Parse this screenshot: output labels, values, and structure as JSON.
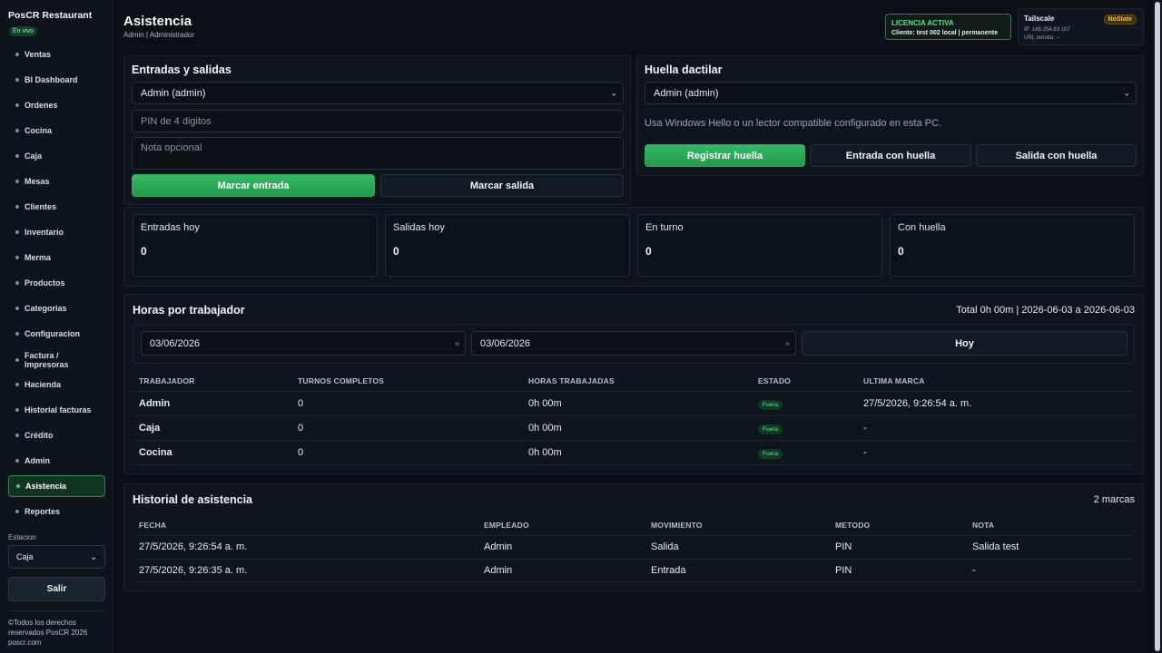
{
  "sidebar": {
    "brand": "PosCR Restaurant",
    "status_badge": "En vivo",
    "items": [
      {
        "label": "Ventas"
      },
      {
        "label": "BI Dashboard"
      },
      {
        "label": "Ordenes"
      },
      {
        "label": "Cocina"
      },
      {
        "label": "Caja"
      },
      {
        "label": "Mesas"
      },
      {
        "label": "Clientes"
      },
      {
        "label": "Inventario"
      },
      {
        "label": "Merma"
      },
      {
        "label": "Productos"
      },
      {
        "label": "Categorias"
      },
      {
        "label": "Configuracion"
      },
      {
        "label": "Factura / Impresoras"
      },
      {
        "label": "Hacienda"
      },
      {
        "label": "Historial facturas"
      },
      {
        "label": "Crédito"
      },
      {
        "label": "Admin"
      },
      {
        "label": "Asistencia",
        "active": true
      },
      {
        "label": "Reportes"
      }
    ],
    "station_label": "Estacion",
    "station_value": "Caja",
    "logout_label": "Salir",
    "footer": "©Todos los derechos reservados PosCR 2026 poscr.com"
  },
  "header": {
    "title": "Asistencia",
    "subtitle": "Admin | Administrador",
    "license_title": "LICENCIA ACTIVA",
    "license_detail": "Cliente: test 002 local | permanente",
    "tailscale_title": "Tailscale",
    "tailscale_badge": "NoState",
    "tailscale_ip": "IP: 169.254.83.107",
    "tailscale_url": "URL remota: --"
  },
  "entries": {
    "title": "Entradas y salidas",
    "employee_select": "Admin (admin)",
    "pin_placeholder": "PIN de 4 digitos",
    "note_placeholder": "Nota opcional",
    "checkin_label": "Marcar entrada",
    "checkout_label": "Marcar salida"
  },
  "fingerprint": {
    "title": "Huella dactilar",
    "employee_select": "Admin (admin)",
    "hint": "Usa Windows Hello o un lector compatible configurado en esta PC.",
    "register_label": "Registrar huella",
    "checkin_label": "Entrada con huella",
    "checkout_label": "Salida con huella"
  },
  "stats": [
    {
      "label": "Entradas hoy",
      "value": "0"
    },
    {
      "label": "Salidas hoy",
      "value": "0"
    },
    {
      "label": "En turno",
      "value": "0"
    },
    {
      "label": "Con huella",
      "value": "0"
    }
  ],
  "hours": {
    "title": "Horas por trabajador",
    "summary": "Total 0h 00m | 2026-06-03 a 2026-06-03",
    "date_from": "03/06/2026",
    "date_to": "03/06/2026",
    "today_label": "Hoy",
    "columns": [
      "TRABAJADOR",
      "TURNOS COMPLETOS",
      "HORAS TRABAJADAS",
      "ESTADO",
      "ULTIMA MARCA"
    ],
    "rows": [
      {
        "worker": "Admin",
        "shifts": "0",
        "hours": "0h 00m",
        "status": "Fuera",
        "last": "27/5/2026, 9:26:54 a. m."
      },
      {
        "worker": "Caja",
        "shifts": "0",
        "hours": "0h 00m",
        "status": "Fuera",
        "last": "-"
      },
      {
        "worker": "Cocina",
        "shifts": "0",
        "hours": "0h 00m",
        "status": "Fuera",
        "last": "-"
      }
    ]
  },
  "history": {
    "title": "Historial de asistencia",
    "count": "2 marcas",
    "columns": [
      "FECHA",
      "EMPLEADO",
      "MOVIMIENTO",
      "METODO",
      "NOTA"
    ],
    "rows": [
      {
        "date": "27/5/2026, 9:26:54 a. m.",
        "employee": "Admin",
        "movement": "Salida",
        "method": "PIN",
        "note": "Salida test"
      },
      {
        "date": "27/5/2026, 9:26:35 a. m.",
        "employee": "Admin",
        "movement": "Entrada",
        "method": "PIN",
        "note": "-"
      }
    ]
  }
}
